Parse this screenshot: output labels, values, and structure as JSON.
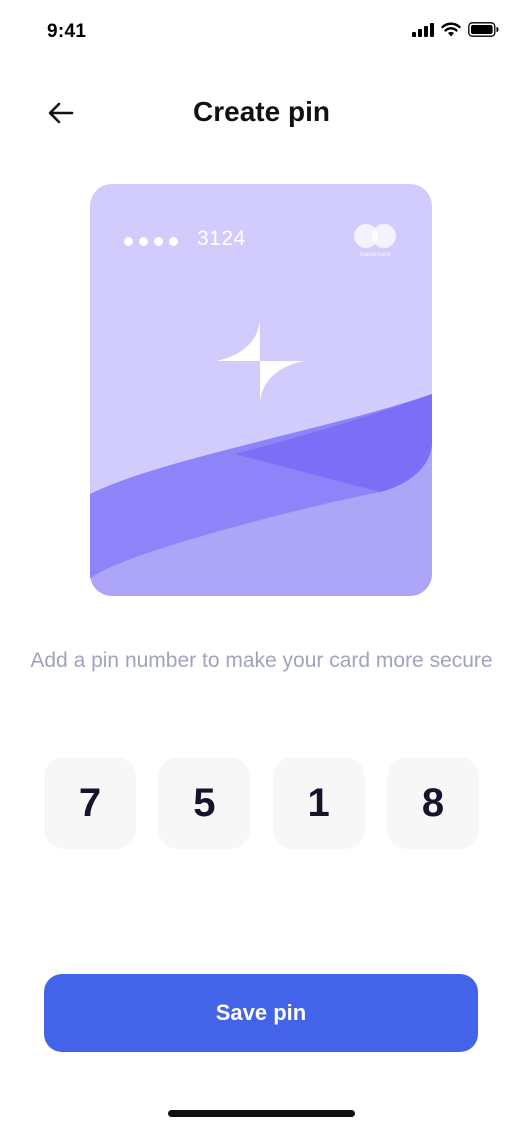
{
  "status_bar": {
    "time": "9:41",
    "icons": [
      "cellular-signal-icon",
      "wifi-icon",
      "battery-icon"
    ]
  },
  "header": {
    "back_icon": "arrow-left-icon",
    "title": "Create pin"
  },
  "card": {
    "masked_digits": "••••",
    "last_digits": "3124",
    "brand": "mastercard",
    "logo_icon": "sparkle-star-icon",
    "colors": {
      "background": "#d1ccfb",
      "wave_light": "#ada6f8",
      "wave_mid": "#8e83f8",
      "wave_dark": "#7d6ef7"
    }
  },
  "instruction": "Add a pin number to make your card more secure",
  "pin": {
    "digits": [
      "7",
      "5",
      "1",
      "8"
    ]
  },
  "save_button": {
    "label": "Save pin",
    "color": "#4364e8"
  }
}
